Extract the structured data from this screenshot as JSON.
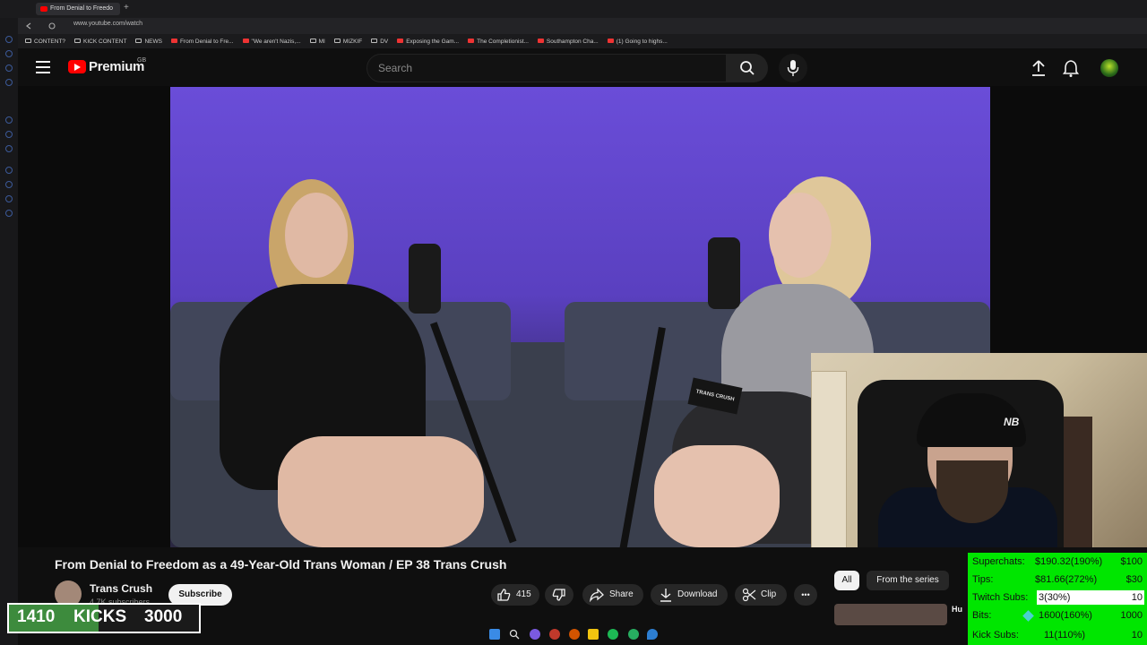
{
  "browser": {
    "active_tab_title": "From Denial to Freedo",
    "new_tab_symbol": "+",
    "url": "www.youtube.com/watch",
    "bookmarks": [
      {
        "label": "CONTENT?",
        "icon": "folder-icon"
      },
      {
        "label": "KICK CONTENT",
        "icon": "folder-icon"
      },
      {
        "label": "NEWS",
        "icon": "folder-icon"
      },
      {
        "label": "From Denial to Fre...",
        "icon": "youtube-icon"
      },
      {
        "label": "\"We aren't Nazis,...",
        "icon": "youtube-icon"
      },
      {
        "label": "MI",
        "icon": "folder-icon"
      },
      {
        "label": "MIZKIF",
        "icon": "folder-icon"
      },
      {
        "label": "DV",
        "icon": "folder-icon"
      },
      {
        "label": "Exposing the Gam...",
        "icon": "youtube-icon"
      },
      {
        "label": "The Completionist...",
        "icon": "youtube-icon"
      },
      {
        "label": "Southampton Cha...",
        "icon": "youtube-icon"
      },
      {
        "label": "(1) Going to highs...",
        "icon": "youtube-icon"
      }
    ]
  },
  "header": {
    "logo_text": "Premium",
    "region": "GB",
    "search_placeholder": "Search"
  },
  "video": {
    "title": "From Denial to Freedom as a 49-Year-Old Trans Woman / EP 38 Trans Crush",
    "channel_name": "Trans Crush",
    "subscriber_count": "4.7K subscribers",
    "subscribe_label": "Subscribe",
    "like_count": "415",
    "share_label": "Share",
    "download_label": "Download",
    "clip_label": "Clip",
    "more_label": "•••",
    "card_text": "TRANS CRUSH"
  },
  "recommendations": {
    "chip_all": "All",
    "chip_series": "From the series",
    "first_title": "Hu"
  },
  "webcam": {
    "cap_logo": "NB"
  },
  "overlay": {
    "kicks_current": "1410",
    "kicks_label": "KICKS",
    "kicks_goal": "3000",
    "kicks_progress": 0.47,
    "stats": [
      {
        "label": "Superchats:",
        "value": "$190.32(190%)",
        "goal": "$100"
      },
      {
        "label": "Tips:",
        "value": "$81.66(272%)",
        "goal": "$30"
      },
      {
        "label": "Twitch Subs:",
        "value": "3(30%)",
        "goal": "10"
      },
      {
        "label": "Bits:",
        "value": "1600(160%)",
        "goal": "1000"
      },
      {
        "label": "Kick Subs:",
        "value": "11(110%)",
        "goal": "10"
      }
    ]
  },
  "colors": {
    "youtube_red": "#ff0000",
    "overlay_green": "#00e600",
    "kicks_green": "#3d8b3d",
    "video_purple": "#6a4dd8"
  }
}
